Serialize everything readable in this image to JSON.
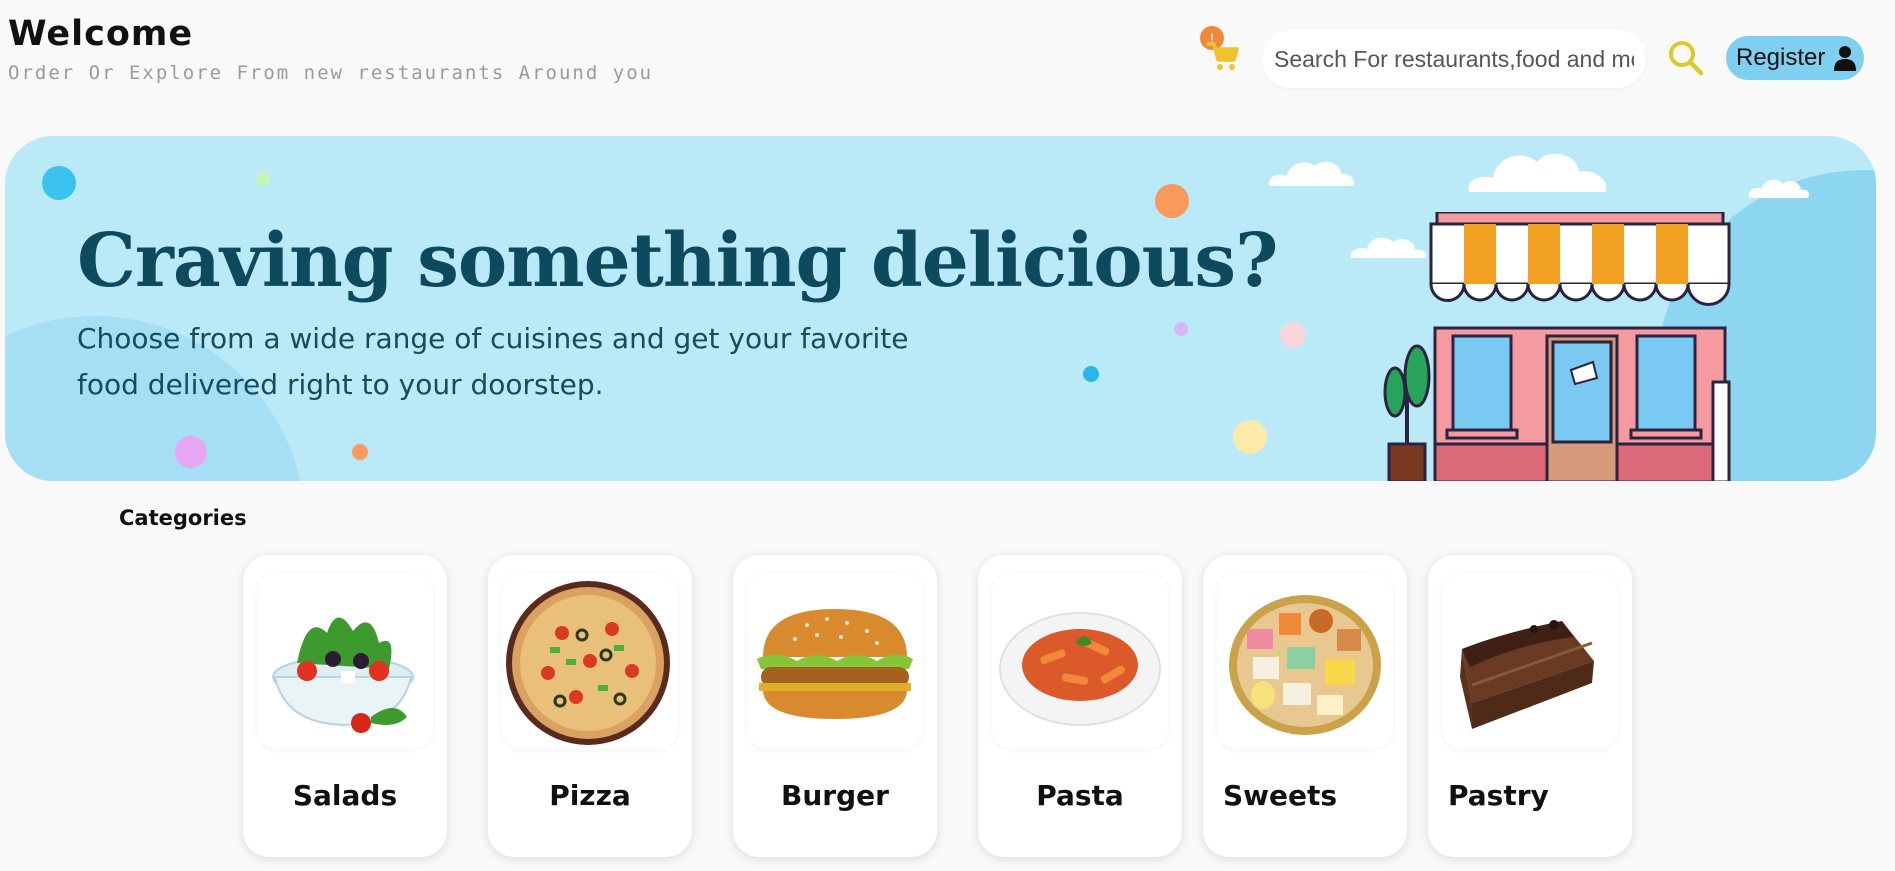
{
  "header": {
    "title": "Welcome",
    "tagline": "Order Or Explore From new restaurants Around you",
    "cart_count": "!",
    "search_placeholder": "Search For restaurants,food and more",
    "register_label": "Register"
  },
  "hero": {
    "title": "Craving something delicious?",
    "subtitle": "Choose from a wide range of cuisines and get your favorite food delivered right to your doorstep."
  },
  "categories": {
    "heading": "Categories",
    "items": [
      {
        "label": "Salads"
      },
      {
        "label": "Pizza"
      },
      {
        "label": "Burger"
      },
      {
        "label": "Pasta"
      },
      {
        "label": "Sweets"
      },
      {
        "label": "Pastry"
      }
    ]
  },
  "colors": {
    "hero_bg": "#bae9f8",
    "accent_yellow": "#f2c12e",
    "register_bg": "#7fcff0",
    "badge": "#f08a3a"
  }
}
